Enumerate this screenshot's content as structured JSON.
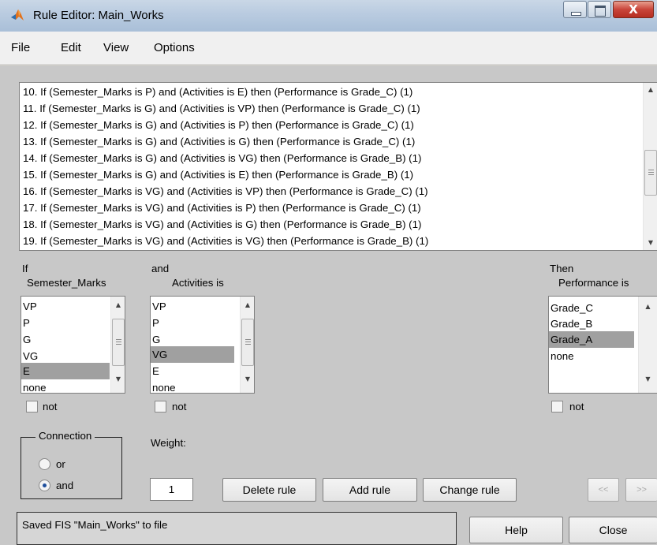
{
  "window": {
    "title": "Rule Editor: Main_Works",
    "close_glyph": "X"
  },
  "menu": [
    "File",
    "Edit",
    "View",
    "Options"
  ],
  "rules": [
    "10. If (Semester_Marks is P) and (Activities is E) then (Performance is Grade_C) (1)",
    "11. If (Semester_Marks is G) and (Activities is VP) then (Performance is Grade_C) (1)",
    "12. If (Semester_Marks is G) and (Activities is P) then (Performance is Grade_C) (1)",
    "13. If (Semester_Marks is G) and (Activities is G) then (Performance is Grade_C) (1)",
    "14. If (Semester_Marks is G) and (Activities is VG) then (Performance is Grade_B) (1)",
    "15. If (Semester_Marks is G) and (Activities is E) then (Performance is Grade_B) (1)",
    "16. If (Semester_Marks is VG) and (Activities is VP) then (Performance is Grade_C) (1)",
    "17. If (Semester_Marks is VG) and (Activities is P) then (Performance is Grade_C) (1)",
    "18. If (Semester_Marks is VG) and (Activities is G) then (Performance is Grade_B) (1)",
    "19. If (Semester_Marks is VG) and (Activities is VG) then (Performance is Grade_B) (1)"
  ],
  "antecedent1": {
    "header": "If",
    "variable": "Semester_Marks",
    "options": [
      "VP",
      "P",
      "G",
      "VG",
      "E",
      "none"
    ],
    "selected_index": 4,
    "not_label": "not"
  },
  "antecedent2": {
    "header": "and",
    "variable": "Activities is",
    "options": [
      "VP",
      "P",
      "G",
      "VG",
      "E",
      "none"
    ],
    "selected_index": 3,
    "not_label": "not"
  },
  "consequent": {
    "header": "Then",
    "variable": "Performance is",
    "options": [
      "Grade_C",
      "Grade_B",
      "Grade_A",
      "none"
    ],
    "selected_index": 2,
    "not_label": "not"
  },
  "connection": {
    "title": "Connection",
    "or_label": "or",
    "and_label": "and",
    "selected": "and"
  },
  "weight": {
    "label": "Weight:",
    "value": "1"
  },
  "buttons": {
    "delete": "Delete rule",
    "add": "Add rule",
    "change": "Change rule",
    "prev": "<<",
    "next": ">>",
    "help": "Help",
    "close": "Close"
  },
  "status": "Saved FIS \"Main_Works\" to file"
}
